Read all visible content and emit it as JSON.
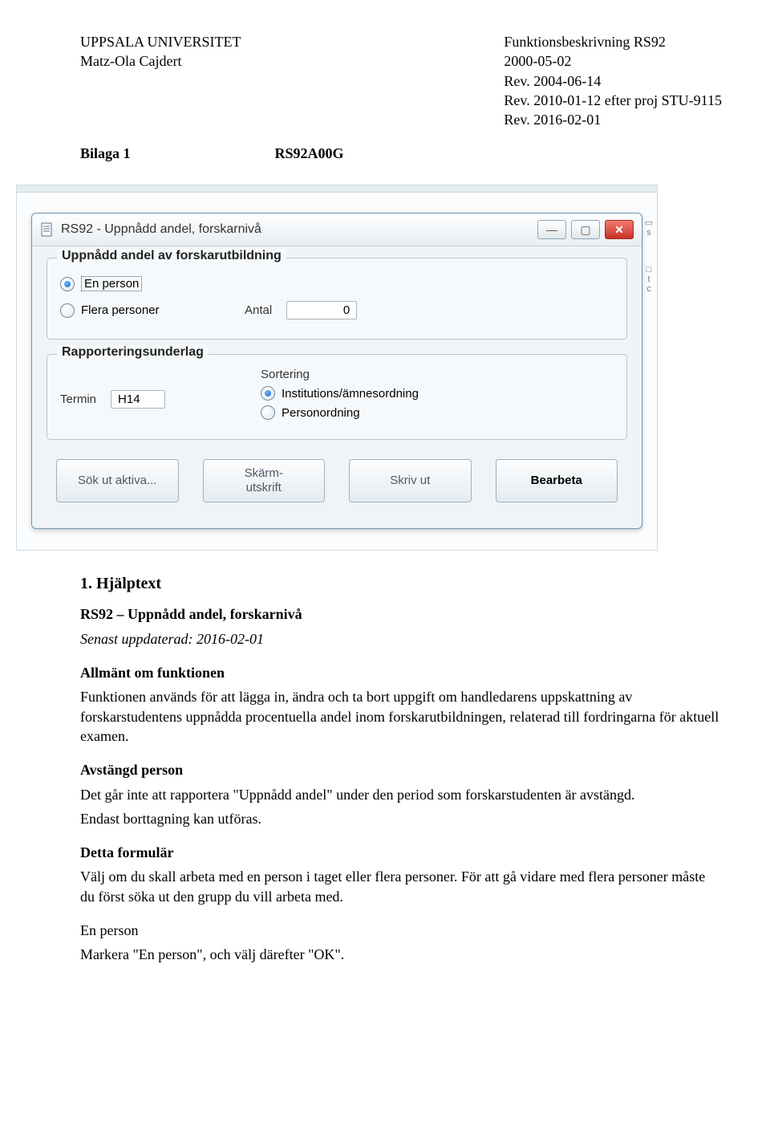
{
  "header": {
    "university": "UPPSALA UNIVERSITET",
    "author": "Matz-Ola Cajdert",
    "doc_title": "Funktionsbeskrivning RS92",
    "date": "2000-05-02",
    "rev1": "Rev. 2004-06-14",
    "rev2": "Rev. 2010-01-12 efter proj STU-9115",
    "rev3": "Rev. 2016-02-01",
    "bilaga": "Bilaga 1",
    "code": "RS92A00G"
  },
  "window": {
    "title": "RS92 - Uppnådd andel, forskarnivå",
    "group1_legend": "Uppnådd andel av forskarutbildning",
    "radio_en_person": "En person",
    "radio_flera": "Flera personer",
    "antal_label": "Antal",
    "antal_value": "0",
    "group2_legend": "Rapporteringsunderlag",
    "termin_label": "Termin",
    "termin_value": "H14",
    "sortering_label": "Sortering",
    "radio_inst": "Institutions/ämnesordning",
    "radio_person": "Personordning",
    "btn_sok": "Sök ut aktiva...",
    "btn_skarm": "Skärm-\nutskrift",
    "btn_skriv": "Skriv ut",
    "btn_bearbeta": "Bearbeta"
  },
  "help": {
    "heading_num": "1.   Hjälptext",
    "title_bold": "RS92 – Uppnådd andel, forskarnivå",
    "updated": "Senast uppdaterad: 2016-02-01",
    "allmant_h": "Allmänt om funktionen",
    "allmant_p": "Funktionen används för att lägga in, ändra och ta bort uppgift om handledarens uppskattning av forskarstudentens uppnådda procentuella andel inom forskarutbildningen, relaterad till fordringarna för aktuell examen.",
    "avstangd_h": "Avstängd person",
    "avstangd_p1": "Det går inte att rapportera \"Uppnådd andel\" under den period som forskarstudenten är avstängd.",
    "avstangd_p2": "Endast borttagning kan utföras.",
    "detta_h": "Detta formulär",
    "detta_p": "Välj om du skall arbeta med en person i taget eller flera personer. För att gå vidare med flera personer måste du först söka ut den grupp du vill arbeta med.",
    "enperson_h": "En person",
    "enperson_p": "Markera \"En person\", och välj därefter \"OK\"."
  }
}
